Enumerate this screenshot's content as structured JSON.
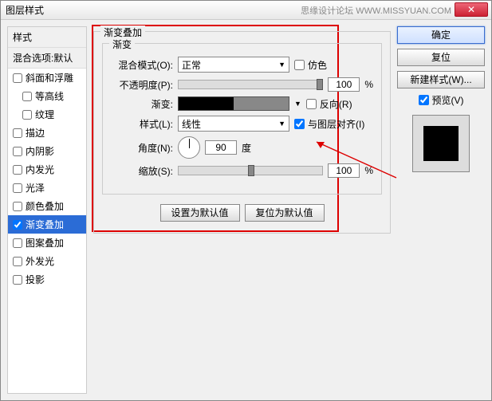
{
  "window": {
    "title": "图层样式",
    "watermark": "思缘设计论坛  WWW.MISSYUAN.COM"
  },
  "sidebar": {
    "header1": "样式",
    "header2": "混合选项:默认",
    "items": [
      {
        "label": "斜面和浮雕",
        "checked": false,
        "indent": false
      },
      {
        "label": "等高线",
        "checked": false,
        "indent": true
      },
      {
        "label": "纹理",
        "checked": false,
        "indent": true
      },
      {
        "label": "描边",
        "checked": false,
        "indent": false
      },
      {
        "label": "内阴影",
        "checked": false,
        "indent": false
      },
      {
        "label": "内发光",
        "checked": false,
        "indent": false
      },
      {
        "label": "光泽",
        "checked": false,
        "indent": false
      },
      {
        "label": "颜色叠加",
        "checked": false,
        "indent": false
      },
      {
        "label": "渐变叠加",
        "checked": true,
        "indent": false,
        "selected": true
      },
      {
        "label": "图案叠加",
        "checked": false,
        "indent": false
      },
      {
        "label": "外发光",
        "checked": false,
        "indent": false
      },
      {
        "label": "投影",
        "checked": false,
        "indent": false
      }
    ]
  },
  "panel": {
    "title": "渐变叠加",
    "sub": "渐变",
    "blendLabel": "混合模式(O):",
    "blendValue": "正常",
    "ditherLabel": "仿色",
    "opacityLabel": "不透明度(P):",
    "opacityValue": "100",
    "pct": "%",
    "gradientLabel": "渐变:",
    "reverseLabel": "反向(R)",
    "styleLabel": "样式(L):",
    "styleValue": "线性",
    "alignLabel": "与图层对齐(I)",
    "angleLabel": "角度(N):",
    "angleValue": "90",
    "deg": "度",
    "scaleLabel": "缩放(S):",
    "scaleValue": "100",
    "resetBtn": "设置为默认值",
    "restoreBtn": "复位为默认值"
  },
  "right": {
    "ok": "确定",
    "cancel": "复位",
    "newStyle": "新建样式(W)...",
    "previewLabel": "预览(V)"
  }
}
